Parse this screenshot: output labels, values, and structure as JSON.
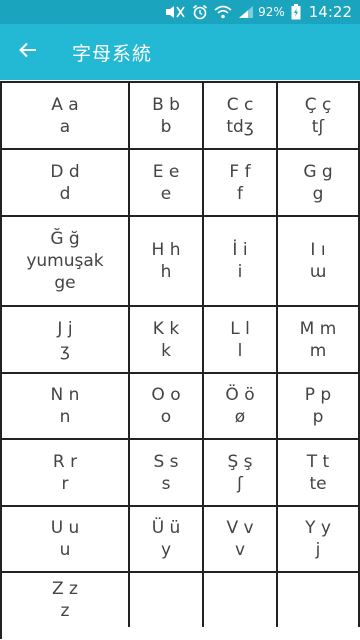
{
  "status_bar": {
    "battery": "92%",
    "time": "14:22",
    "icons": [
      "mute-icon",
      "alarm-icon",
      "wifi-icon",
      "signal-icon",
      "battery-charging-icon"
    ]
  },
  "app_bar": {
    "back_icon": "arrow-left-icon",
    "title": "字母系統"
  },
  "alphabet": [
    {
      "letter": "A a",
      "ipa": "a"
    },
    {
      "letter": "B b",
      "ipa": "b"
    },
    {
      "letter": "C c",
      "ipa": "tdʒ"
    },
    {
      "letter": "Ç ç",
      "ipa": "tʃ"
    },
    {
      "letter": "D d",
      "ipa": "d"
    },
    {
      "letter": "E e",
      "ipa": "e"
    },
    {
      "letter": "F f",
      "ipa": "f"
    },
    {
      "letter": "G g",
      "ipa": "g"
    },
    {
      "letter": "Ğ ğ",
      "ipa": "yumuşak ge"
    },
    {
      "letter": "H h",
      "ipa": "h"
    },
    {
      "letter": "İ i",
      "ipa": "i"
    },
    {
      "letter": "I ı",
      "ipa": "ɯ"
    },
    {
      "letter": "J j",
      "ipa": "ʒ"
    },
    {
      "letter": "K k",
      "ipa": "k"
    },
    {
      "letter": "L l",
      "ipa": "l"
    },
    {
      "letter": "M m",
      "ipa": "m"
    },
    {
      "letter": "N n",
      "ipa": "n"
    },
    {
      "letter": "O o",
      "ipa": "o"
    },
    {
      "letter": "Ö ö",
      "ipa": "ø"
    },
    {
      "letter": "P p",
      "ipa": "p"
    },
    {
      "letter": "R r",
      "ipa": "r"
    },
    {
      "letter": "S s",
      "ipa": "s"
    },
    {
      "letter": "Ş ş",
      "ipa": "ʃ"
    },
    {
      "letter": "T t",
      "ipa": "te"
    },
    {
      "letter": "U u",
      "ipa": "u"
    },
    {
      "letter": "Ü ü",
      "ipa": "y"
    },
    {
      "letter": "V v",
      "ipa": "v"
    },
    {
      "letter": "Y y",
      "ipa": "j"
    },
    {
      "letter": "Z z",
      "ipa": "z"
    }
  ],
  "colors": {
    "status_bar": "#1aa4bd",
    "app_bar": "#23b8d4",
    "grid_line": "#222222",
    "cell_text": "#444444"
  }
}
